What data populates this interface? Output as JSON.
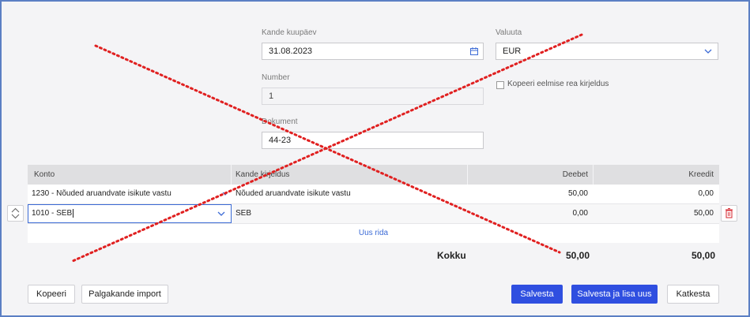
{
  "form": {
    "date_label": "Kande kuupäev",
    "date_value": "31.08.2023",
    "currency_label": "Valuuta",
    "currency_value": "EUR",
    "number_label": "Number",
    "number_value": "1",
    "document_label": "Dokument",
    "document_value": "44-23",
    "copy_desc_label": "Kopeeri eelmise rea kirjeldus"
  },
  "table": {
    "headers": [
      "Konto",
      "Kande kirjeldus",
      "Deebet",
      "Kreedit"
    ],
    "rows": [
      {
        "account": "1230 - Nõuded aruandvate isikute vastu",
        "description": "Nõuded aruandvate isikute vastu",
        "debit": "50,00",
        "credit": "0,00"
      },
      {
        "account": "1010 - SEB",
        "description": "SEB",
        "debit": "0,00",
        "credit": "50,00"
      }
    ],
    "new_row": "Uus rida"
  },
  "totals": {
    "label": "Kokku",
    "debit": "50,00",
    "credit": "50,00"
  },
  "buttons": {
    "copy": "Kopeeri",
    "payroll_import": "Palgakande import",
    "save": "Salvesta",
    "save_new": "Salvesta ja lisa uus",
    "cancel": "Katkesta"
  },
  "colors": {
    "primary": "#2f4fe0",
    "link": "#3c6bd6",
    "overlay_cross": "#e02020",
    "frame": "#5b7fc4"
  }
}
